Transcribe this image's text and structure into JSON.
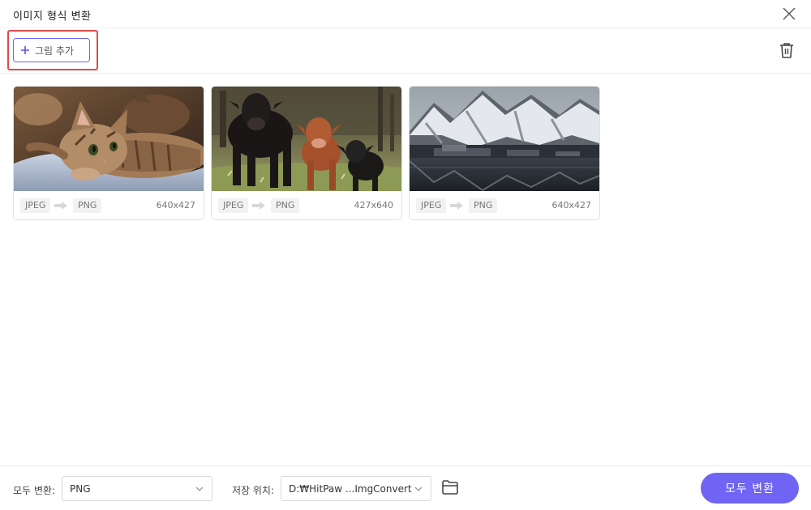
{
  "window": {
    "title": "이미지 형식 변환"
  },
  "toolbar": {
    "add_label": "그림 추가"
  },
  "images": [
    {
      "source_format": "JPEG",
      "target_format": "PNG",
      "dimensions": "640x427",
      "subject": "kitten photo"
    },
    {
      "source_format": "JPEG",
      "target_format": "PNG",
      "dimensions": "427x640",
      "subject": "cows photo"
    },
    {
      "source_format": "JPEG",
      "target_format": "PNG",
      "dimensions": "640x427",
      "subject": "snowy mountain lake photo"
    }
  ],
  "bottom": {
    "convert_all_label": "모두 변환:",
    "format_value": "PNG",
    "save_location_label": "저장 위치:",
    "save_path": "D:₩HitPaw ...ImgConvert",
    "convert_all_button": "모두 변환"
  },
  "colors": {
    "accent": "#6f64f3",
    "highlight": "#e04a4a"
  },
  "icons": [
    "close-icon",
    "plus-icon",
    "trash-icon",
    "arrow-right-icon",
    "chevron-down-icon",
    "folder-icon"
  ]
}
